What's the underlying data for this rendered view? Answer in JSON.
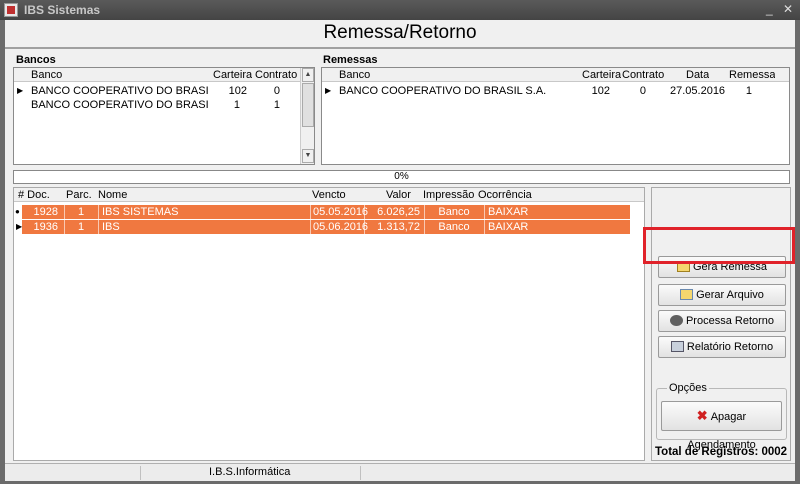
{
  "window": {
    "title": "IBS Sistemas",
    "minimize": "_",
    "close": "✕"
  },
  "header": {
    "title": "Remessa/Retorno"
  },
  "bancos": {
    "group_title": "Bancos",
    "columns": [
      "Banco",
      "Carteira",
      "Contrato"
    ],
    "rows": [
      {
        "banco": "BANCO COOPERATIVO DO BRASIL S",
        "carteira": "102",
        "contrato": "0"
      },
      {
        "banco": "BANCO COOPERATIVO DO BRASIL S",
        "carteira": "1",
        "contrato": "1"
      }
    ]
  },
  "remessas": {
    "group_title": "Remessas",
    "columns": [
      "Banco",
      "Carteira",
      "Contrato",
      "Data",
      "Remessa"
    ],
    "rows": [
      {
        "banco": "BANCO COOPERATIVO DO BRASIL S.A.",
        "carteira": "102",
        "contrato": "0",
        "data": "27.05.2016",
        "remessa": "1"
      }
    ]
  },
  "progress": {
    "label": "0%",
    "value": 0
  },
  "documents": {
    "columns": [
      "# Doc.",
      "Parc.",
      "Nome",
      "Vencto",
      "Valor",
      "Impressão",
      "Ocorrência"
    ],
    "rows": [
      {
        "doc": "1928",
        "parc": "1",
        "nome": "IBS SISTEMAS",
        "vencto": "05.05.2016",
        "valor": "6.026,25",
        "impressao": "Banco",
        "ocorrencia": "BAIXAR"
      },
      {
        "doc": "1936",
        "parc": "1",
        "nome": "IBS",
        "vencto": "05.06.2016",
        "valor": "1.313,72",
        "impressao": "Banco",
        "ocorrencia": "BAIXAR"
      }
    ],
    "row_color": "#f07840"
  },
  "actions": {
    "gera_remessa": "Gera Remessa",
    "gerar_arquivo": "Gerar Arquivo",
    "processa_retorno": "Processa Retorno",
    "relatorio_retorno": "Relatório Retorno"
  },
  "opcoes": {
    "legend": "Opções",
    "apagar_agendamento": "Apagar Agendamento"
  },
  "total": {
    "label": "Total de Registros: 0002"
  },
  "statusbar": {
    "company": "I.B.S.Informática"
  },
  "colors": {
    "highlight": "#e0222a",
    "title_bar": "#4a4a4a"
  }
}
